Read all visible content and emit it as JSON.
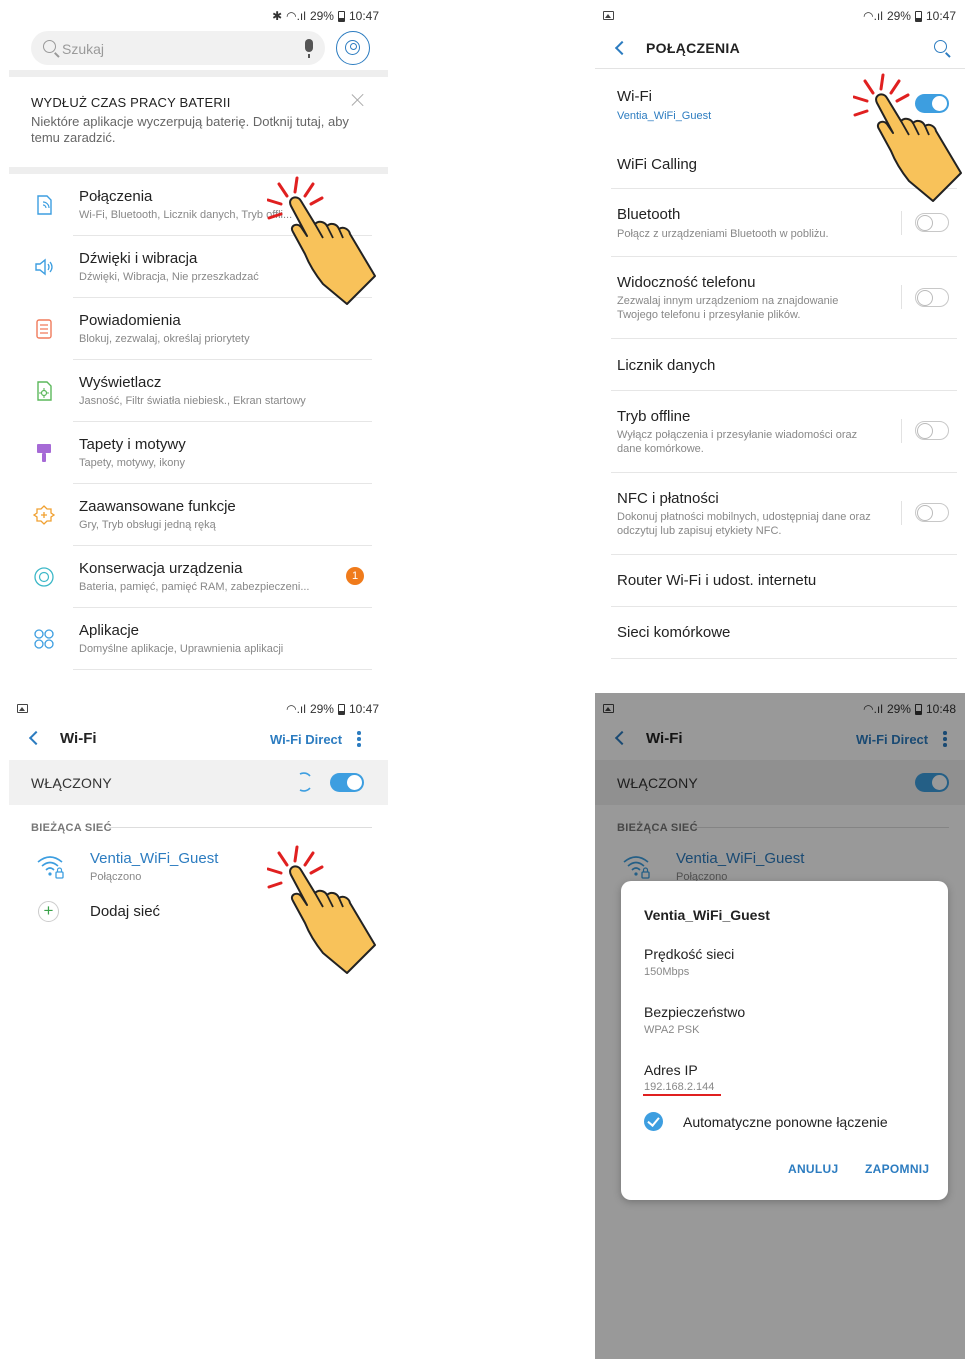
{
  "status": {
    "battery": "29%",
    "time_1": "10:47",
    "time_4": "10:48"
  },
  "screen1": {
    "search_placeholder": "Szukaj",
    "tip_title": "WYDŁUŻ CZAS PRACY BATERII",
    "tip_body": "Niektóre aplikacje wyczerpują baterię. Dotknij tutaj, aby temu zaradzić.",
    "items": [
      {
        "title": "Połączenia",
        "subtitle": "Wi-Fi, Bluetooth, Licznik danych, Tryb offli..."
      },
      {
        "title": "Dźwięki i wibracja",
        "subtitle": "Dźwięki, Wibracja, Nie przeszkadzać"
      },
      {
        "title": "Powiadomienia",
        "subtitle": "Blokuj, zezwalaj, określaj priorytety"
      },
      {
        "title": "Wyświetlacz",
        "subtitle": "Jasność, Filtr światła niebiesk., Ekran startowy"
      },
      {
        "title": "Tapety i motywy",
        "subtitle": "Tapety, motywy, ikony"
      },
      {
        "title": "Zaawansowane funkcje",
        "subtitle": "Gry, Tryb obsługi jedną ręką"
      },
      {
        "title": "Konserwacja urządzenia",
        "subtitle": "Bateria, pamięć, pamięć RAM, zabezpieczeni...",
        "badge": "1"
      },
      {
        "title": "Aplikacje",
        "subtitle": "Domyślne aplikacje, Uprawnienia aplikacji"
      }
    ]
  },
  "screen2": {
    "title": "POŁĄCZENIA",
    "items": [
      {
        "title": "Wi-Fi",
        "subtitle": "Ventia_WiFi_Guest",
        "toggle": "on"
      },
      {
        "title": "WiFi Calling"
      },
      {
        "title": "Bluetooth",
        "subtitle": "Połącz z urządzeniami Bluetooth w pobliżu.",
        "toggle": "off"
      },
      {
        "title": "Widoczność telefonu",
        "subtitle": "Zezwalaj innym urządzeniom na znajdowanie Twojego telefonu i przesyłanie plików.",
        "toggle": "off"
      },
      {
        "title": "Licznik danych"
      },
      {
        "title": "Tryb offline",
        "subtitle": "Wyłącz połączenia i przesyłanie wiadomości oraz dane komórkowe.",
        "toggle": "off"
      },
      {
        "title": "NFC i płatności",
        "subtitle": "Dokonuj płatności mobilnych, udostępniaj dane oraz odczytuj lub zapisuj etykiety NFC.",
        "toggle": "off"
      },
      {
        "title": "Router Wi-Fi i udost. internetu"
      },
      {
        "title": "Sieci komórkowe"
      }
    ]
  },
  "screen3": {
    "title": "Wi-Fi",
    "wifi_direct": "Wi-Fi Direct",
    "on_label": "WŁĄCZONY",
    "section": "BIEŻĄCA SIEĆ",
    "network_name": "Ventia_WiFi_Guest",
    "network_status": "Połączono",
    "add_label": "Dodaj sieć"
  },
  "screen4": {
    "title": "Wi-Fi",
    "wifi_direct": "Wi-Fi Direct",
    "on_label": "WŁĄCZONY",
    "section": "BIEŻĄCA SIEĆ",
    "network_name": "Ventia_WiFi_Guest",
    "network_status": "Połączono",
    "dialog": {
      "title": "Ventia_WiFi_Guest",
      "speed_label": "Prędkość sieci",
      "speed_value": "150Mbps",
      "security_label": "Bezpieczeństwo",
      "security_value": "WPA2 PSK",
      "ip_label": "Adres IP",
      "ip_value": "192.168.2.144",
      "auto_label": "Automatyczne ponowne łączenie",
      "cancel": "ANULUJ",
      "forget": "ZAPOMNIJ"
    }
  },
  "colors": {
    "accent": "#2c7cc0",
    "toggle_on": "#3d9ee0",
    "badge": "#f07b1b",
    "hand_fill": "#f8c25a",
    "tap_marks": "#e02020"
  }
}
